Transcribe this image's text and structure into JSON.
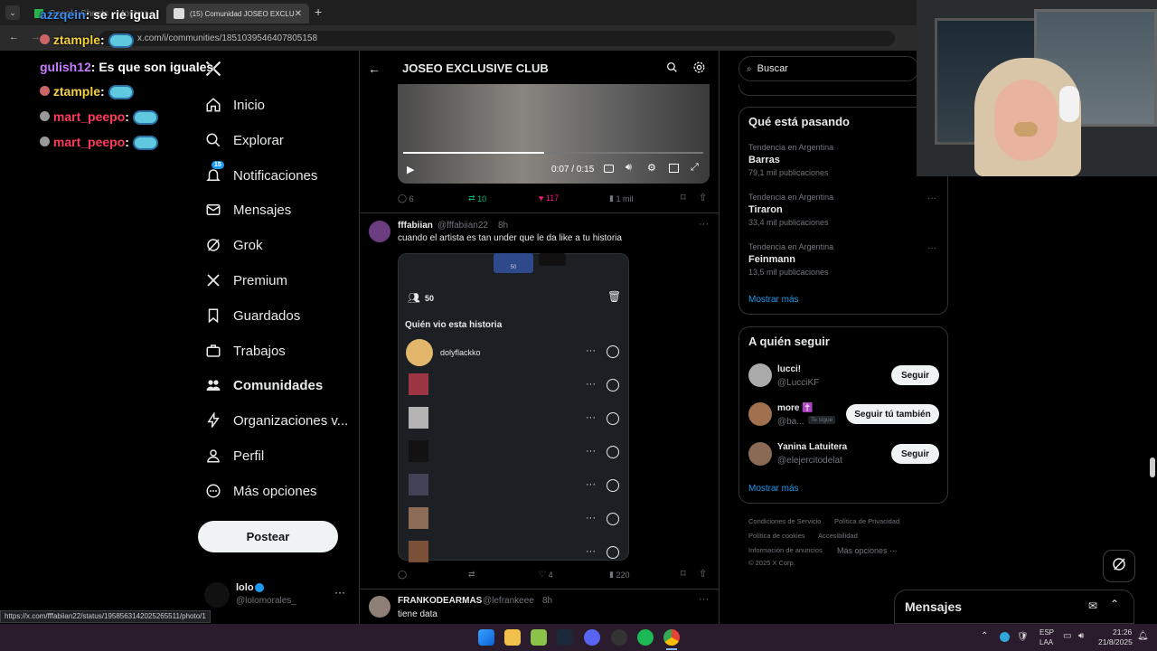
{
  "browser": {
    "tabs": [
      {
        "label": "Google Sheets - Mostrar"
      },
      {
        "label": "(15) Comunidad JOSEO EXCLU"
      }
    ],
    "url": "x.com/i/communities/1851039546407805158",
    "status_url": "https://x.com/fffabiian22/status/1958563142025265511/photo/1"
  },
  "nav": {
    "items": [
      {
        "label": "Inicio"
      },
      {
        "label": "Explorar"
      },
      {
        "label": "Notificaciones",
        "badge": "15"
      },
      {
        "label": "Mensajes"
      },
      {
        "label": "Grok"
      },
      {
        "label": "Premium"
      },
      {
        "label": "Guardados"
      },
      {
        "label": "Trabajos"
      },
      {
        "label": "Comunidades"
      },
      {
        "label": "Organizaciones v..."
      },
      {
        "label": "Perfil"
      },
      {
        "label": "Más opciones"
      }
    ],
    "post_button": "Postear",
    "account": {
      "name": "lolo",
      "handle": "@lolomorales_"
    }
  },
  "header": {
    "title": "JOSEO EXCLUSIVE CLUB"
  },
  "video": {
    "time": "0:07 / 0:15",
    "progress": 0.47,
    "stats": {
      "replies": "6",
      "reposts": "10",
      "likes": "117",
      "views": "1 mil"
    }
  },
  "post1": {
    "author": "fffabiian",
    "handle": "@fffabiian22",
    "time": "8h",
    "text": "cuando el artista es tan under que le da like a tu historia",
    "story": {
      "count": "50",
      "title": "Quién vio esta historia",
      "first_viewer": "dolyflackko",
      "thumb_label": "50"
    },
    "stats": {
      "replies": "",
      "reposts": "",
      "likes": "4",
      "views": "220"
    }
  },
  "post2": {
    "author": "FRANKODEARMAS",
    "handle": "@lefrankeee",
    "time": "8h",
    "text": "tiene data"
  },
  "right": {
    "search_placeholder": "Buscar",
    "trends_title": "Qué está pasando",
    "trends": [
      {
        "category": "Tendencia en Argentina",
        "name": "Barras",
        "count": "79,1 mil publicaciones"
      },
      {
        "category": "Tendencia en Argentina",
        "name": "Tiraron",
        "count": "33,4 mil publicaciones"
      },
      {
        "category": "Tendencia en Argentina",
        "name": "Feinmann",
        "count": "13,5 mil publicaciones"
      }
    ],
    "show_more": "Mostrar más",
    "follow_title": "A quién seguir",
    "follow": [
      {
        "name": "lucci!",
        "handle": "@LucciKF",
        "button": "Seguir",
        "badge": ""
      },
      {
        "name": "more ✝️",
        "handle": "@ba...",
        "button": "Seguir tú también",
        "badge": "Te sigue"
      },
      {
        "name": "Yanina Latuitera",
        "handle": "@elejercitodelat",
        "button": "Seguir",
        "badge": ""
      }
    ],
    "follow_more": "Mostrar más",
    "footer": {
      "l1": "Condiciones de Servicio",
      "l2": "Política de Privacidad",
      "l3": "Política de cookies",
      "l4": "Accesibilidad",
      "l5": "Información de anuncios",
      "l6": "Más opciones ···",
      "l7": "© 2025 X Corp."
    },
    "messages": "Mensajes"
  },
  "chat": [
    {
      "user": "azzqein",
      "text": ": se rie igual",
      "color": "#3a8ff0"
    },
    {
      "user": "ztample",
      "text": ":",
      "color": "#f4d03f"
    },
    {
      "user": "gulish12",
      "text": ": Es que son iguales",
      "color": "#c77dff"
    },
    {
      "user": "ztample",
      "text": ":",
      "color": "#f4d03f"
    },
    {
      "user": "mart_peepo",
      "text": ":",
      "color": "#ff3b5c"
    },
    {
      "user": "mart_peepo",
      "text": ":",
      "color": "#ff3b5c"
    }
  ],
  "taskbar": {
    "lang1": "ESP",
    "lang2": "LAA",
    "time": "21:26",
    "date": "21/8/2025"
  }
}
